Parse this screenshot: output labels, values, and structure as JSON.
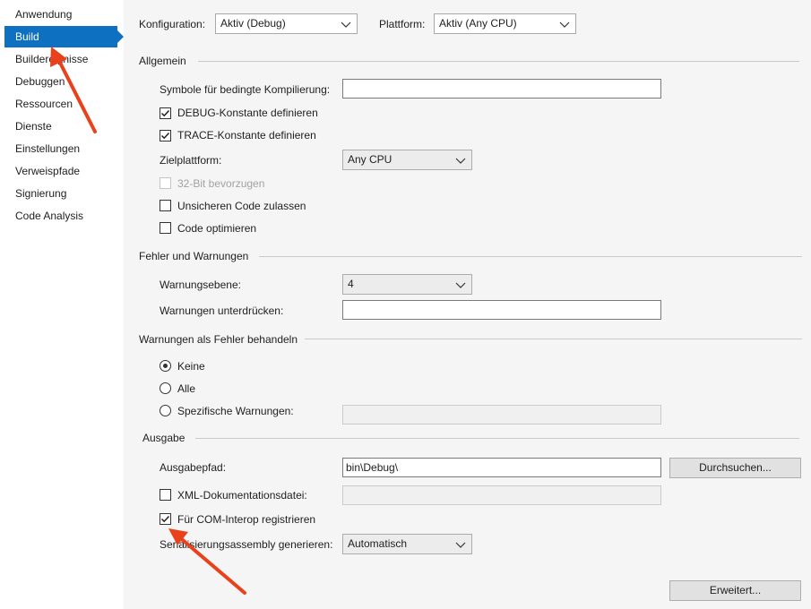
{
  "sidebar": {
    "items": [
      {
        "label": "Anwendung"
      },
      {
        "label": "Build"
      },
      {
        "label": "Buildereignisse"
      },
      {
        "label": "Debuggen"
      },
      {
        "label": "Ressourcen"
      },
      {
        "label": "Dienste"
      },
      {
        "label": "Einstellungen"
      },
      {
        "label": "Verweispfade"
      },
      {
        "label": "Signierung"
      },
      {
        "label": "Code Analysis"
      }
    ],
    "selected": "Build"
  },
  "header": {
    "config_label": "Konfiguration:",
    "config_value": "Aktiv (Debug)",
    "platform_label": "Plattform:",
    "platform_value": "Aktiv (Any CPU)"
  },
  "allgemein": {
    "title": "Allgemein",
    "symbols_label": "Symbole für bedingte Kompilierung:",
    "symbols_value": "",
    "debug_const_label": "DEBUG-Konstante definieren",
    "debug_const_checked": true,
    "trace_const_label": "TRACE-Konstante definieren",
    "trace_const_checked": true,
    "target_label": "Zielplattform:",
    "target_value": "Any CPU",
    "prefer32_label": "32-Bit bevorzugen",
    "prefer32_checked": false,
    "unsafe_label": "Unsicheren Code zulassen",
    "unsafe_checked": false,
    "optimize_label": "Code optimieren",
    "optimize_checked": false
  },
  "fehler": {
    "title": "Fehler und Warnungen",
    "level_label": "Warnungsebene:",
    "level_value": "4",
    "suppress_label": "Warnungen unterdrücken:",
    "suppress_value": ""
  },
  "treat": {
    "title": "Warnungen als Fehler behandeln",
    "options": [
      "Keine",
      "Alle",
      "Spezifische Warnungen:"
    ],
    "selected": "Keine",
    "specific_value": ""
  },
  "ausgabe": {
    "title": "Ausgabe",
    "path_label": "Ausgabepfad:",
    "path_value": "bin\\Debug\\",
    "browse_label": "Durchsuchen...",
    "xml_label": "XML-Dokumentationsdatei:",
    "xml_checked": false,
    "xml_value": "",
    "com_label": "Für COM-Interop registrieren",
    "com_checked": true,
    "serial_label": "Serialisierungsassembly generieren:",
    "serial_value": "Automatisch"
  },
  "advanced_label": "Erweitert...",
  "colors": {
    "accent": "#0e70c0",
    "annotation_arrow": "#e8411b"
  }
}
